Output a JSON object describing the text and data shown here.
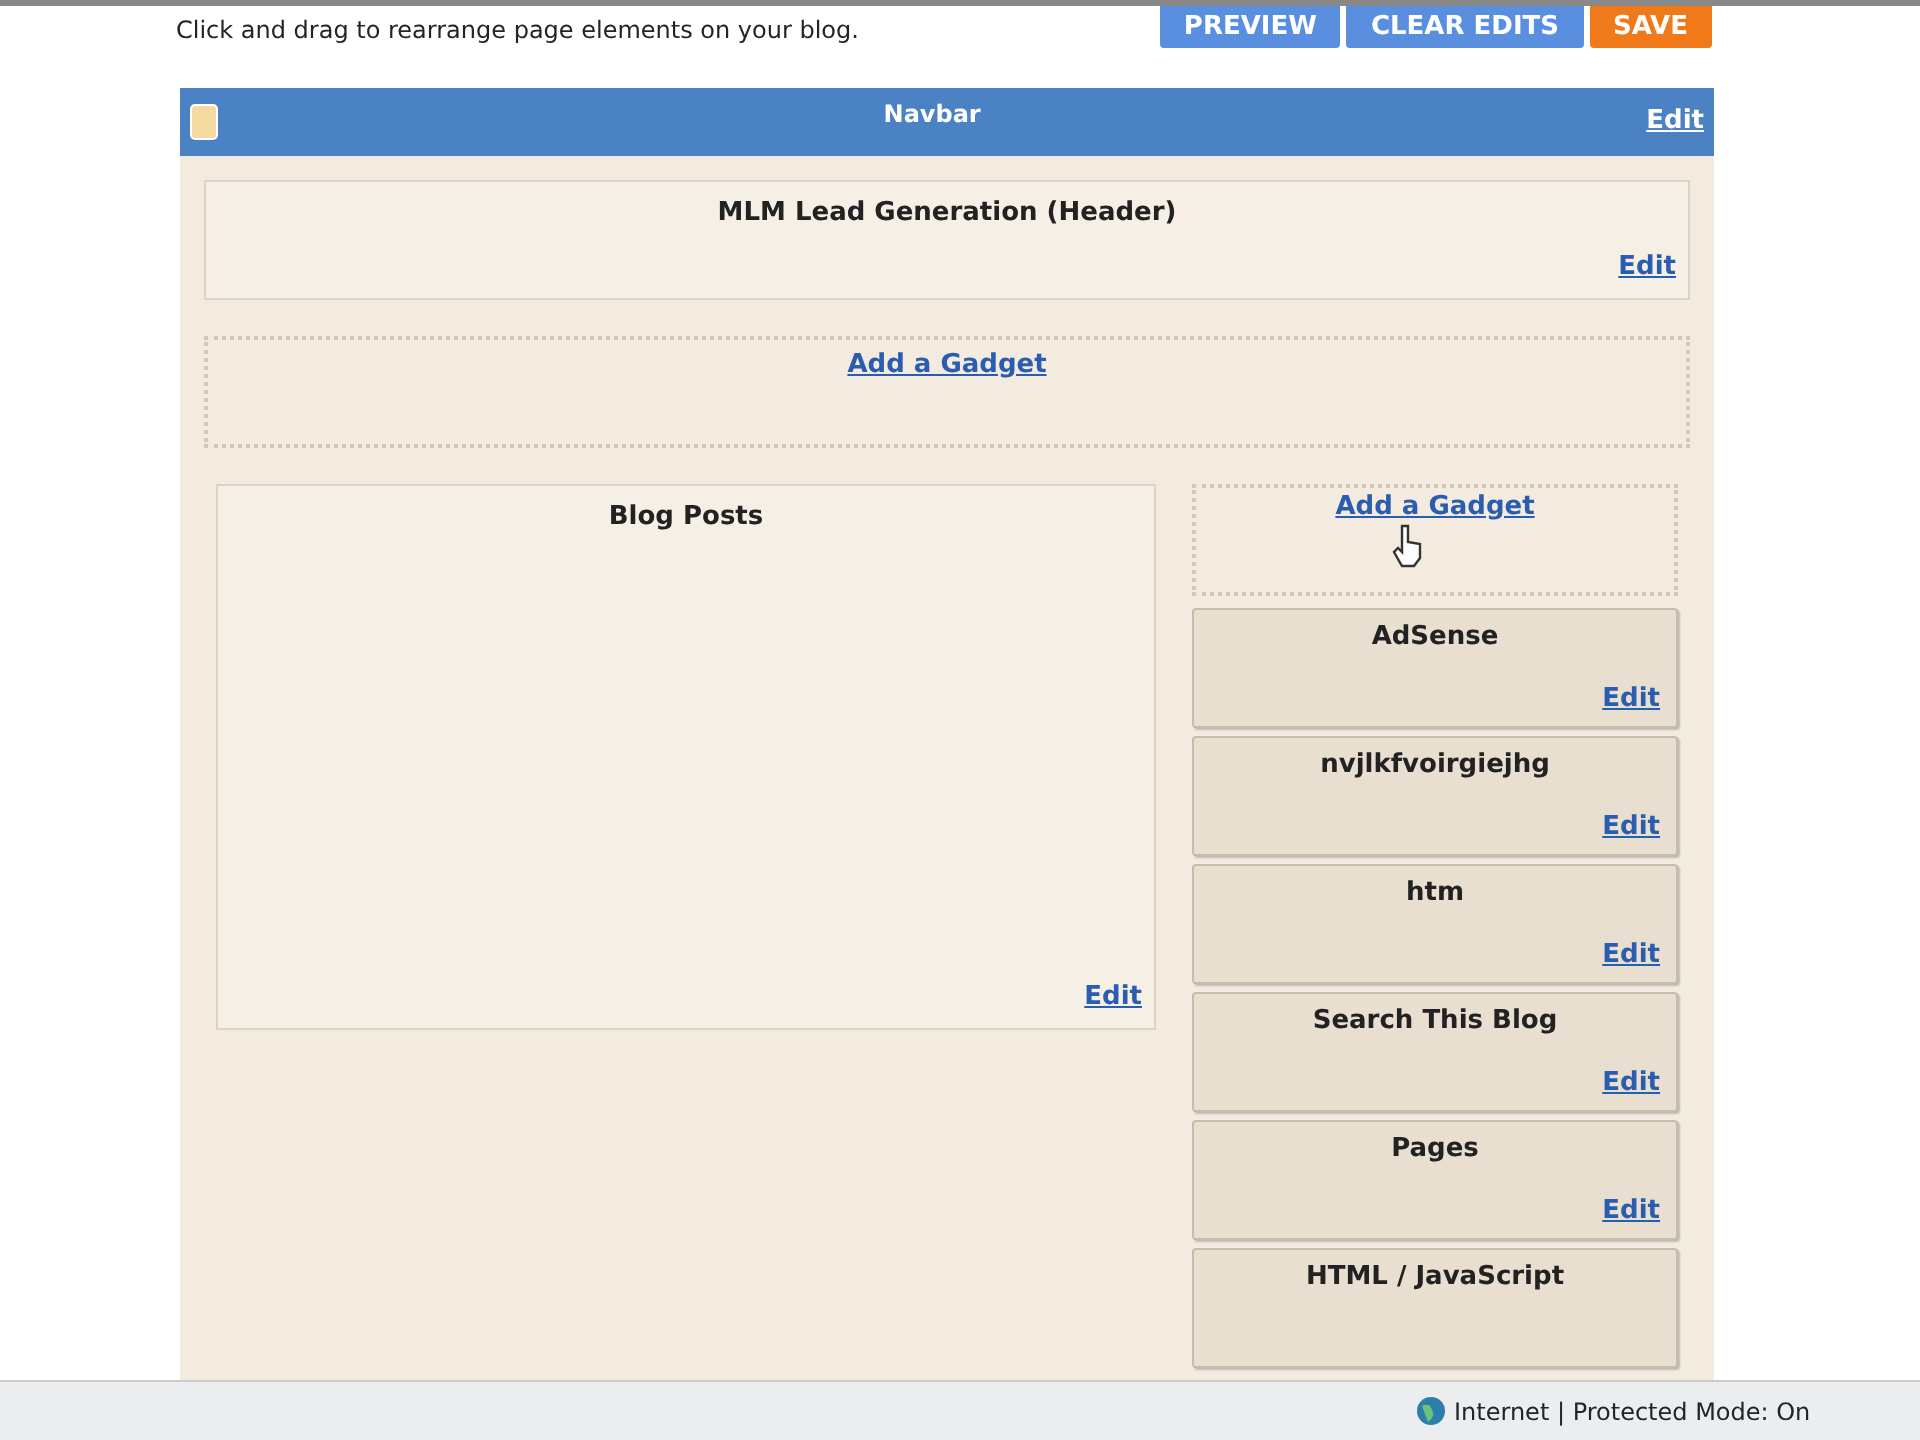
{
  "instructions": "Click and drag to rearrange page elements on your blog.",
  "buttons": [
    {
      "label": "PREVIEW",
      "kind": "blue"
    },
    {
      "label": "CLEAR EDITS",
      "kind": "blue"
    },
    {
      "label": "SAVE",
      "kind": "orange"
    }
  ],
  "navbar": {
    "title": "Navbar",
    "edit": "Edit"
  },
  "header": {
    "title": "MLM Lead Generation (Header)",
    "edit": "Edit"
  },
  "add_gadget_top": "Add a Gadget",
  "main": {
    "title": "Blog Posts",
    "edit": "Edit"
  },
  "sidebar": {
    "add_gadget": "Add a Gadget",
    "gadgets": [
      {
        "title": "AdSense",
        "edit": "Edit"
      },
      {
        "title": "nvjlkfvoirgiejhg",
        "edit": "Edit"
      },
      {
        "title": "htm",
        "edit": "Edit"
      },
      {
        "title": "Search This Blog",
        "edit": "Edit"
      },
      {
        "title": "Pages",
        "edit": "Edit"
      },
      {
        "title": "HTML / JavaScript"
      }
    ]
  },
  "status_bar": {
    "zone": "Internet | Protected Mode: On"
  }
}
